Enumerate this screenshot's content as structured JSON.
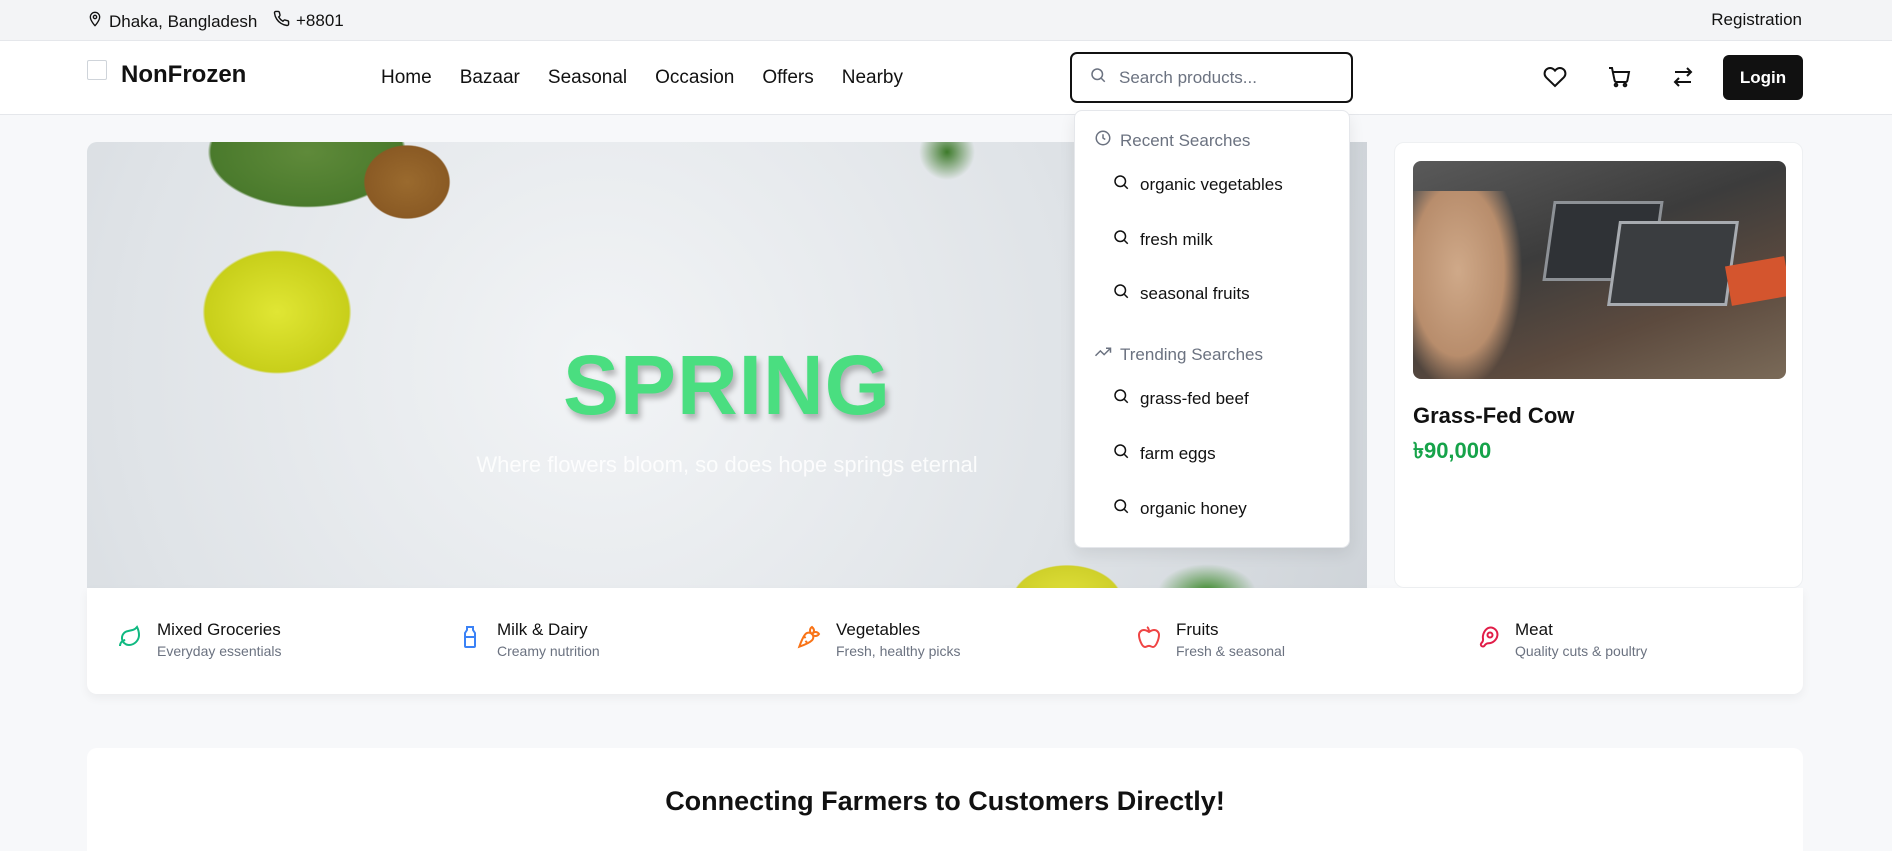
{
  "topbar": {
    "location": "Dhaka, Bangladesh",
    "phone": "+8801",
    "registration": "Registration"
  },
  "navbar": {
    "brand": "NonFrozen",
    "links": [
      "Home",
      "Bazaar",
      "Seasonal",
      "Occasion",
      "Offers",
      "Nearby"
    ],
    "search_placeholder": "Search products...",
    "login": "Login",
    "icons": [
      "heart-icon",
      "cart-icon",
      "compare-icon"
    ]
  },
  "search_dropdown": {
    "recent_header": "Recent Searches",
    "recent": [
      "organic vegetables",
      "fresh milk",
      "seasonal fruits"
    ],
    "trending_header": "Trending Searches",
    "trending": [
      "grass-fed beef",
      "farm eggs",
      "organic honey"
    ]
  },
  "hero": {
    "title": "SPRING",
    "subtitle": "Where flowers bloom, so does hope springs eternal"
  },
  "featured_product": {
    "name": "Grass-Fed Cow",
    "price": "৳90,000"
  },
  "categories": [
    {
      "title": "Mixed Groceries",
      "subtitle": "Everyday essentials",
      "icon": "leaf-icon",
      "color": "#10b981"
    },
    {
      "title": "Milk & Dairy",
      "subtitle": "Creamy nutrition",
      "icon": "milk-bottle-icon",
      "color": "#3b82f6"
    },
    {
      "title": "Vegetables",
      "subtitle": "Fresh, healthy picks",
      "icon": "carrot-icon",
      "color": "#f97316"
    },
    {
      "title": "Fruits",
      "subtitle": "Fresh & seasonal",
      "icon": "apple-icon",
      "color": "#ef4444"
    },
    {
      "title": "Meat",
      "subtitle": "Quality cuts & poultry",
      "icon": "meat-icon",
      "color": "#e11d48"
    }
  ],
  "section": {
    "title": "Connecting Farmers to Customers Directly!"
  }
}
